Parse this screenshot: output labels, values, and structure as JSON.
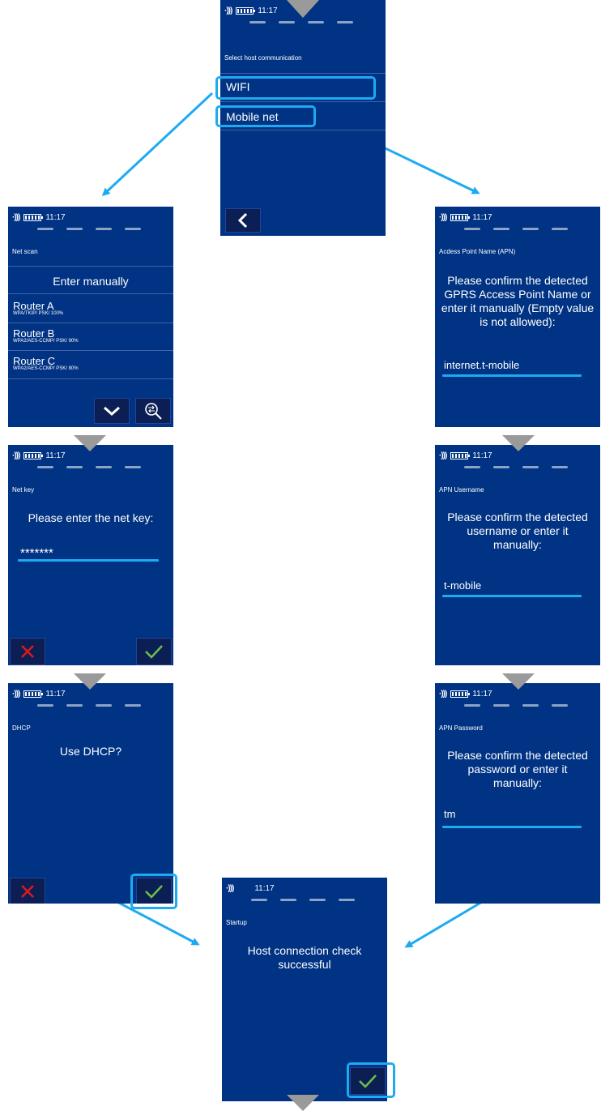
{
  "time": "11:17",
  "colors": {
    "background": "#003383",
    "accent": "#1eaaf1",
    "arrow": "#1eaaf1",
    "confirm": "#6cc04a",
    "cancel": "#e0161f"
  },
  "host_select": {
    "title": "Select host communication",
    "items": [
      "WIFI",
      "Mobile net"
    ]
  },
  "net_scan": {
    "title": "Net scan",
    "enter_manually": "Enter manually",
    "routers": [
      {
        "name": "Router A",
        "detail": "WPA/TKIP/ PSK/ 100%"
      },
      {
        "name": "Router B",
        "detail": "WPA2/AES-CCMP/ PSK/ 90%"
      },
      {
        "name": "Router C",
        "detail": "WPA2/AES-CCMP/ PSK/ 80%"
      }
    ]
  },
  "net_key": {
    "title": "Net key",
    "message": "Please enter the net key:",
    "value": "*******"
  },
  "dhcp": {
    "title": "DHCP",
    "message": "Use DHCP?"
  },
  "apn": {
    "title": "Acdess Point Name (APN)",
    "message": "Please confirm the detected GPRS Access Point Name or enter it manually (Empty value is not allowed):",
    "value": "internet.t-mobile"
  },
  "apn_username": {
    "title": "APN Username",
    "message": "Please confirm the detected username or enter it manually:",
    "value": "t-mobile"
  },
  "apn_password": {
    "title": "APN Password",
    "message": "Please confirm the detected password or enter it manually:",
    "value": "tm"
  },
  "startup": {
    "title": "Startup",
    "message": "Host connection check successful"
  },
  "icons": [
    "signal-icon",
    "battery-icon",
    "back-icon",
    "chevron-down-icon",
    "wifi-search-icon",
    "cancel-icon",
    "confirm-icon",
    "flow-arrow",
    "down-triangle-icon"
  ]
}
